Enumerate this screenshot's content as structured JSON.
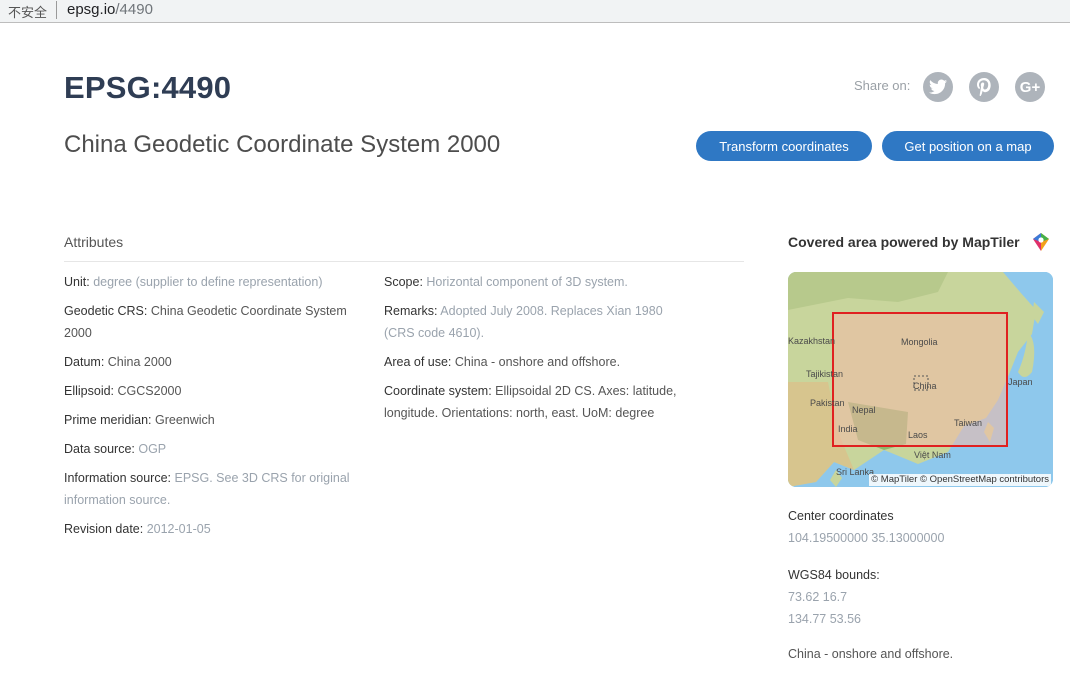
{
  "browser": {
    "security_label": "不安全",
    "url_host": "epsg.io",
    "url_path": "/4490"
  },
  "header": {
    "code": "EPSG:4490",
    "name": "China Geodetic Coordinate System 2000",
    "share_label": "Share on:",
    "share_icons": [
      "twitter-icon",
      "pinterest-icon",
      "google-plus-icon"
    ],
    "google_plus_text": "G+",
    "transform_button": "Transform coordinates",
    "position_button": "Get position on a map"
  },
  "attributes": {
    "heading": "Attributes",
    "left": [
      {
        "label": "Unit:",
        "value": "degree (supplier to define representation)",
        "muted": true
      },
      {
        "label": "Geodetic CRS:",
        "value": "China Geodetic Coordinate System 2000",
        "muted": false
      },
      {
        "label": "Datum:",
        "value": "China 2000",
        "muted": false
      },
      {
        "label": "Ellipsoid:",
        "value": "CGCS2000",
        "muted": false
      },
      {
        "label": "Prime meridian:",
        "value": "Greenwich",
        "muted": false
      },
      {
        "label": "Data source:",
        "value": "OGP",
        "muted": true
      },
      {
        "label": "Information source:",
        "value": "EPSG. See 3D CRS for original information source.",
        "muted": true
      },
      {
        "label": "Revision date:",
        "value": "2012-01-05",
        "muted": true
      }
    ],
    "right": [
      {
        "label": "Scope:",
        "value": "Horizontal component of 3D system.",
        "muted": true
      },
      {
        "label": "Remarks:",
        "value": "Adopted July 2008. Replaces Xian 1980 (CRS code 4610).",
        "muted": true
      },
      {
        "label": "Area of use:",
        "value": "China - onshore and offshore.",
        "muted": false
      },
      {
        "label": "Coordinate system:",
        "value": "Ellipsoidal 2D CS. Axes: latitude, longitude. Orientations: north, east. UoM: degree",
        "muted": false
      }
    ]
  },
  "sidebar": {
    "title": "Covered area powered by MapTiler",
    "map": {
      "attribution": "© MapTiler © OpenStreetMap contributors",
      "labels": [
        "Kazakhstan",
        "Mongolia",
        "Tajikistan",
        "China",
        "Japan",
        "Pakistan",
        "Nepal",
        "India",
        "Taiwan",
        "Laos",
        "Việt Nam",
        "Sri Lanka"
      ],
      "bbox_color": "#e02020"
    },
    "center_label": "Center coordinates",
    "center_value": "104.19500000 35.13000000",
    "bounds_label": "WGS84 bounds:",
    "bounds_min": "73.62 16.7",
    "bounds_max": "134.77 53.56",
    "area_text": "China - onshore and offshore."
  },
  "colors": {
    "title": "#2f3d54",
    "button": "#2f78c4",
    "social": "#aeb4bb",
    "muted": "#9aa3ad"
  }
}
